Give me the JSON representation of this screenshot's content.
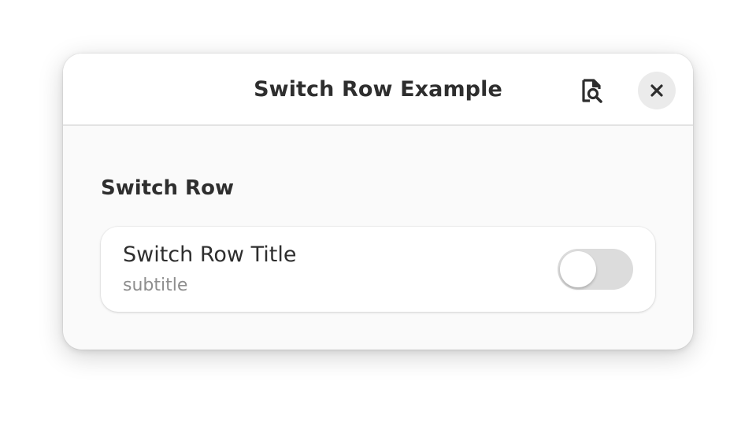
{
  "window": {
    "title": "Switch Row Example"
  },
  "headerbar": {
    "inspect_icon": "inspector-icon",
    "close_icon": "close-icon"
  },
  "group": {
    "title": "Switch Row"
  },
  "row": {
    "title": "Switch Row Title",
    "subtitle": "subtitle",
    "switch_active": false
  },
  "colors": {
    "window_bg": "#fafafa",
    "headerbar_bg": "#ffffff",
    "text": "#2e2e2e",
    "subtitle_text": "#8e8e8e",
    "switch_off_track": "#dcdcdc",
    "close_button_bg": "#ebebeb"
  }
}
